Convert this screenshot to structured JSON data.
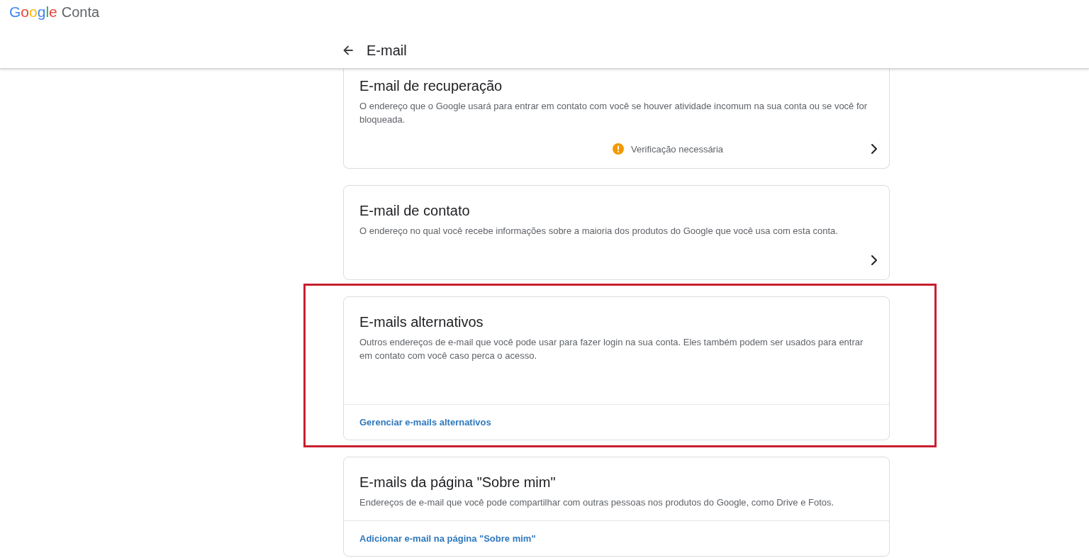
{
  "header": {
    "logo": {
      "brand": "Google",
      "product": "Conta"
    }
  },
  "page": {
    "title": "E-mail"
  },
  "cards": [
    {
      "kind": "chevron",
      "title": "E-mail de recuperação",
      "description": "O endereço que o Google usará para entrar em contato com você se houver atividade incomum na sua conta ou se você for bloqueada.",
      "status": {
        "kind": "warning",
        "text": "Verificação necessária"
      },
      "highlighted": false
    },
    {
      "kind": "chevron",
      "title": "E-mail de contato",
      "description": "O endereço no qual você recebe informações sobre a maioria dos produtos do Google que você usa com esta conta.",
      "highlighted": false
    },
    {
      "kind": "link",
      "title": "E-mails alternativos",
      "description": "Outros endereços de e-mail que você pode usar para fazer login na sua conta. Eles também podem ser usados para entrar em contato com você caso perca o acesso.",
      "link": "Gerenciar e-mails alternativos",
      "highlighted": true
    },
    {
      "kind": "link",
      "title": "E-mails da página \"Sobre mim\"",
      "description": "Endereços de e-mail que você pode compartilhar com outras pessoas nos produtos do Google, como Drive e Fotos.",
      "link": "Adicionar e-mail na página \"Sobre mim\"",
      "highlighted": false
    }
  ]
}
